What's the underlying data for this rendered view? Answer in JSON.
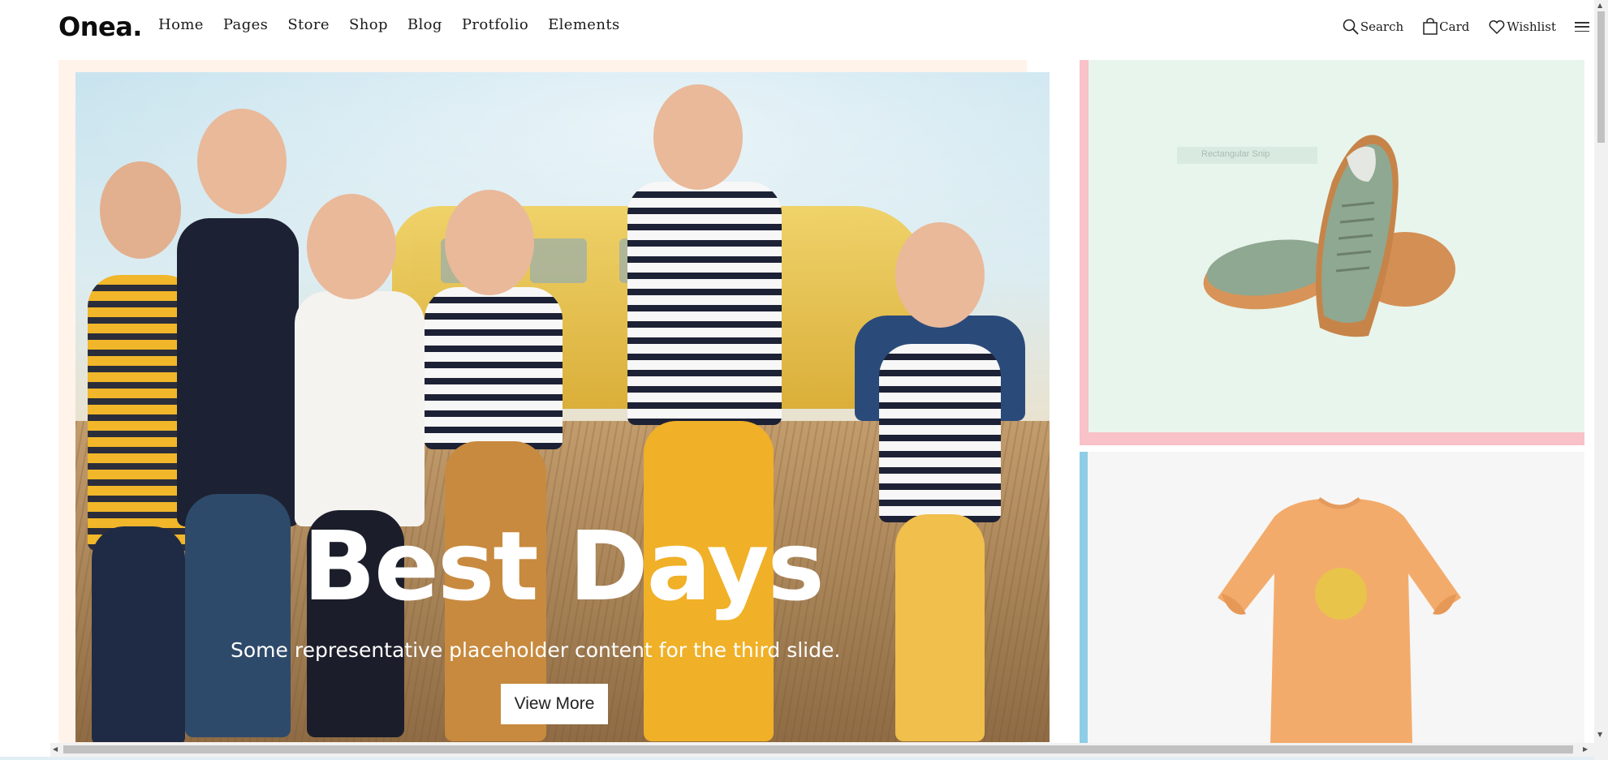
{
  "brand": {
    "logo": "Onea."
  },
  "nav": {
    "items": [
      "Home",
      "Pages",
      "Store",
      "Shop",
      "Blog",
      "Protfolio",
      "Elements"
    ]
  },
  "tools": {
    "search": "Search",
    "card": "Card",
    "wishlist": "Wishlist"
  },
  "hero": {
    "title": "Best Days",
    "subtitle": "Some representative placeholder content for the third slide.",
    "button": "View More"
  },
  "products": {
    "ghost_label": "Rectangular Snip"
  },
  "colors": {
    "hero_frame": "#fff3ea",
    "product1_bg": "#e8f5ec",
    "product1_border": "#f9c1c8",
    "product2_bg": "#f6f6f6",
    "product2_border": "#8ecde6"
  }
}
